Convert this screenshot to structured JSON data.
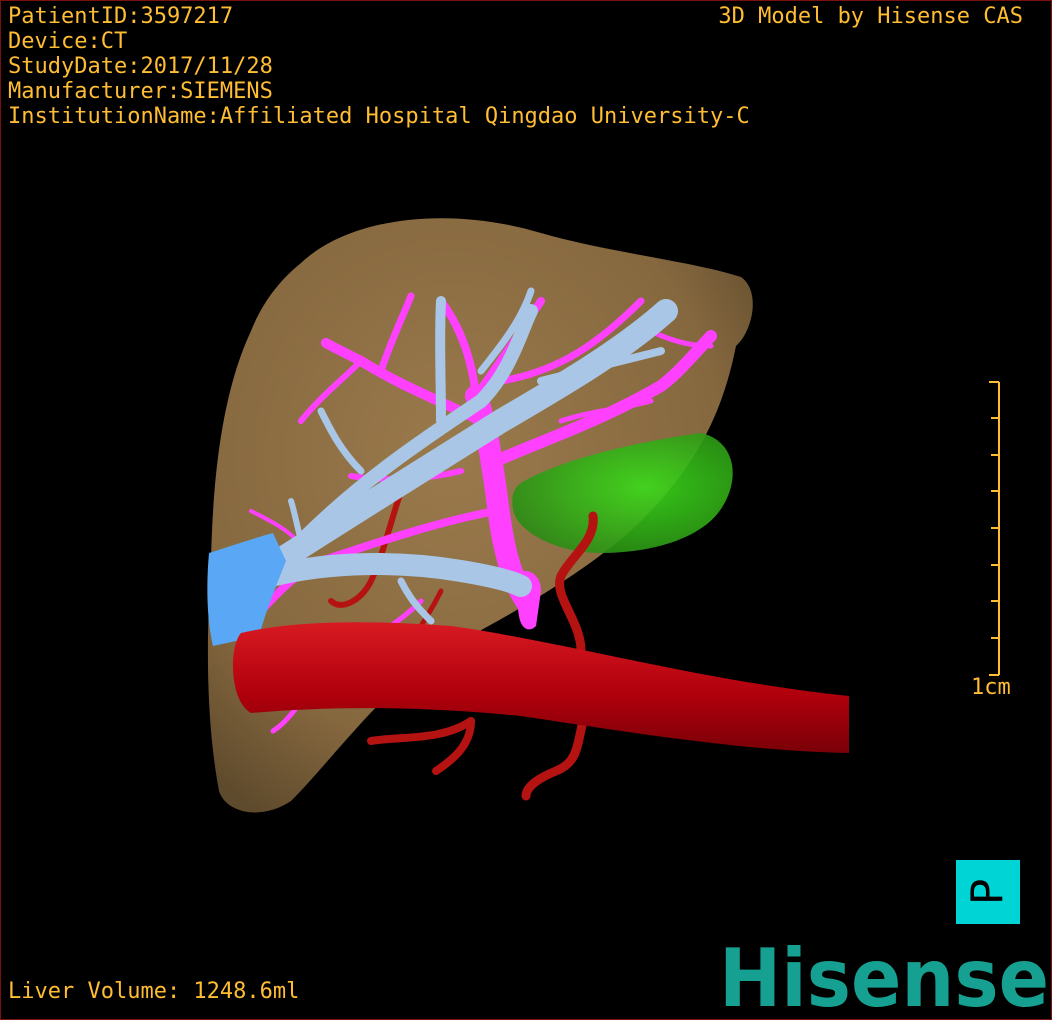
{
  "overlay": {
    "patient_id": "PatientID:3597217",
    "device": "Device:CT",
    "study_date": "StudyDate:2017/11/28",
    "manufacturer": "Manufacturer:SIEMENS",
    "institution": "InstitutionName:Affiliated Hospital Qingdao University-C",
    "credit": "3D Model by Hisense CAS",
    "liver_volume": "Liver Volume: 1248.6ml"
  },
  "scale_bar": {
    "label": "1cm"
  },
  "orientation_cube": {
    "label": "P"
  },
  "brand": {
    "logo_text": "Hisense"
  },
  "colors": {
    "overlay_text": "#ffbd33",
    "liver": "#8a6a40",
    "portal_vein": "#ff40ff",
    "hepatic_vein": "#a9c6e6",
    "ivc": "#5aa8f5",
    "aorta": "#c00010",
    "artery": "#b01010",
    "gallbladder": "#3ec81e",
    "orientation_cube": "#00d4d4",
    "brand": "#16a092"
  }
}
